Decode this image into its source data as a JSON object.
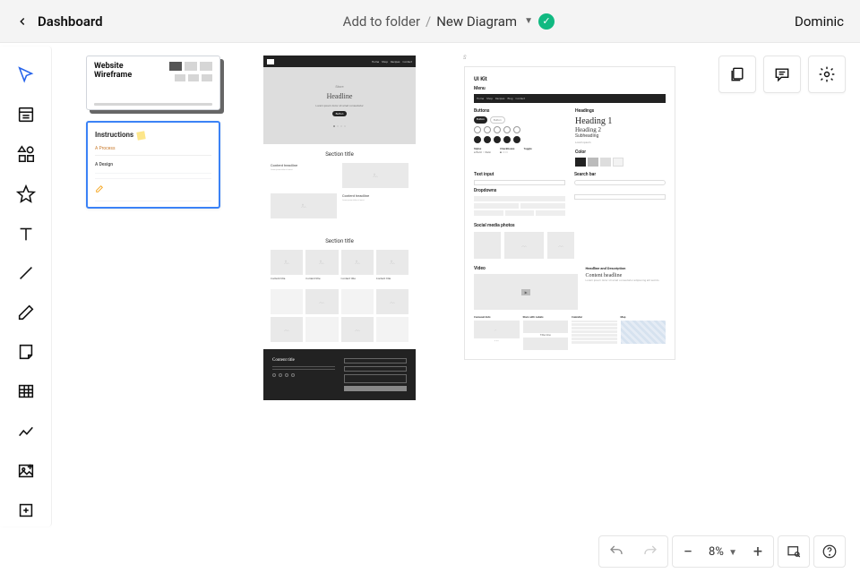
{
  "header": {
    "back_label": "Dashboard",
    "folder_label": "Add to folder",
    "doc_name": "New Diagram",
    "user": "Dominic"
  },
  "tools": [
    {
      "name": "pointer",
      "active": true
    },
    {
      "name": "template"
    },
    {
      "name": "shapes"
    },
    {
      "name": "star"
    },
    {
      "name": "text"
    },
    {
      "name": "line"
    },
    {
      "name": "pencil"
    },
    {
      "name": "note"
    },
    {
      "name": "table"
    },
    {
      "name": "chart"
    },
    {
      "name": "image"
    },
    {
      "name": "frame"
    }
  ],
  "canvas_actions": [
    {
      "name": "pages"
    },
    {
      "name": "comments"
    },
    {
      "name": "settings"
    }
  ],
  "pages": {
    "thumb1_title": "Website Wireframe",
    "thumb2_title": "Instructions",
    "thumb2_sub1": "A Process",
    "thumb2_sub2": "A Design"
  },
  "wireframe_center": {
    "nav_items": [
      "Home",
      "Shop",
      "Recipes",
      "Contact"
    ],
    "hero_eyebrow": "Store",
    "hero_title": "Headline",
    "hero_sub": "Lorem ipsum dolor sit amet consectetur",
    "hero_btn": "Button",
    "section1_title": "Section title",
    "content_headline": "Content headline",
    "section2_title": "Section title",
    "card_title": "Content title",
    "footer_title": "Content title",
    "footer_btn": "Button"
  },
  "wireframe_right": {
    "canvas_label": "S",
    "kit_title": "UI Kit",
    "menu": "Menu",
    "buttons_label": "Buttons",
    "btn_text": "Button",
    "headings_label": "Headings",
    "h1": "Heading 1",
    "h2": "Heading 2",
    "h3": "Subheading",
    "styles": "Styles",
    "checkboxes": "Checkboxes",
    "toggle": "Toggle",
    "text_input": "Text input",
    "search_bar": "Search bar",
    "dropdowns": "Dropdowns",
    "social": "Social media photos",
    "color": "Color",
    "video": "Video",
    "headline_desc": "Headline and Description",
    "content_headline": "Content headline",
    "carousel": "Carousel dots",
    "stars": "Stars with Labels",
    "calendar": "Calendar",
    "map": "Map"
  },
  "bottombar": {
    "zoom": "8%"
  }
}
